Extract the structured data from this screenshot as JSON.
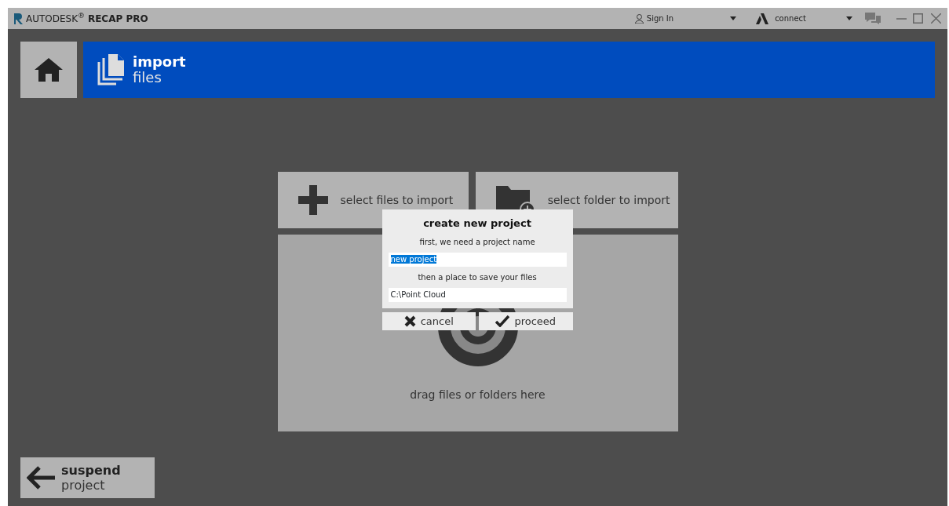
{
  "window": {
    "title": "AUTODESK$^{®}$ **RECAP PRO**",
    "sign_in": "Sign In",
    "connect": "connect"
  },
  "header": {
    "title": "import",
    "subtitle": "files"
  },
  "tiles": [
    {
      "kind": "files",
      "label": "select files to import"
    },
    {
      "kind": "folder",
      "label": "select folder to import"
    }
  ],
  "drop_area": {
    "label": "drag files or folders here"
  },
  "dialog": {
    "title": "create new project",
    "name_prompt": "first, we need a project name",
    "name_value": "new project",
    "name_selected": true,
    "path_prompt": "then a place to save your files",
    "path_value": "C:\\Point Cloud",
    "buttons": [
      {
        "kind": "cancel",
        "label": "cancel"
      },
      {
        "kind": "proceed",
        "label": "proceed"
      }
    ]
  },
  "footer": {
    "title": "suspend",
    "subtitle": "project"
  }
}
